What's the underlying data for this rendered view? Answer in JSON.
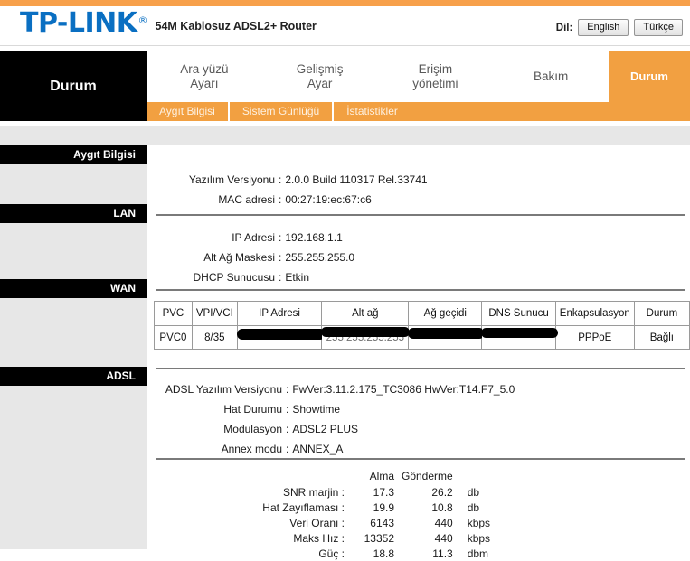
{
  "header": {
    "brand": "TP-LINK",
    "registered_mark": "®",
    "model": "54M Kablosuz ADSL2+ Router",
    "lang_label": "Dil:",
    "lang_buttons": [
      "English",
      "Türkçe"
    ]
  },
  "panel_title": "Durum",
  "nav": {
    "tabs": [
      {
        "label": "Ara yüzü\nAyarı",
        "active": false
      },
      {
        "label": "Gelişmiş\nAyar",
        "active": false
      },
      {
        "label": "Erişim\nyönetimi",
        "active": false
      },
      {
        "label": "Bakım",
        "active": false
      },
      {
        "label": "Durum",
        "active": true
      }
    ],
    "subnav": [
      {
        "label": "Aygıt Bilgisi",
        "active": true
      },
      {
        "label": "Sistem Günlüğü",
        "active": false
      },
      {
        "label": "İstatistikler",
        "active": false
      }
    ]
  },
  "sections": {
    "device_info": {
      "heading": "Aygıt Bilgisi",
      "rows": [
        {
          "key": "Yazılım Versiyonu",
          "value": "2.0.0 Build 110317 Rel.33741"
        },
        {
          "key": "MAC adresi",
          "value": "00:27:19:ec:67:c6"
        }
      ]
    },
    "lan": {
      "heading": "LAN",
      "rows": [
        {
          "key": "IP Adresi",
          "value": "192.168.1.1"
        },
        {
          "key": "Alt Ağ Maskesi",
          "value": "255.255.255.0"
        },
        {
          "key": "DHCP Sunucusu",
          "value": "Etkin"
        }
      ]
    },
    "wan": {
      "heading": "WAN",
      "columns": [
        "PVC",
        "VPI/VCI",
        "IP Adresi",
        "Alt ağ",
        "Ağ geçidi",
        "DNS Sunucu",
        "Enkapsulasyon",
        "Durum"
      ],
      "rows": [
        {
          "pvc": "PVC0",
          "vpi_vci": "8/35",
          "ip_adresi": "",
          "alt_ag": "255.255.255.255",
          "ag_gecidi": "",
          "dns_sunucu": "",
          "enkapsulasyon": "PPPoE",
          "durum": "Bağlı"
        }
      ]
    },
    "adsl": {
      "heading": "ADSL",
      "rows": [
        {
          "key": "ADSL Yazılım Versiyonu",
          "value": "FwVer:3.11.2.175_TC3086 HwVer:T14.F7_5.0"
        },
        {
          "key": "Hat Durumu",
          "value": "Showtime"
        },
        {
          "key": "Modulasyon",
          "value": "ADSL2 PLUS"
        },
        {
          "key": "Annex modu",
          "value": "ANNEX_A"
        }
      ],
      "stats": {
        "col_headers": [
          "Alma",
          "Gönderme"
        ],
        "rows": [
          {
            "label": "SNR marjin :",
            "alma": "17.3",
            "gonderme": "26.2",
            "unit": "db"
          },
          {
            "label": "Hat Zayıflaması :",
            "alma": "19.9",
            "gonderme": "10.8",
            "unit": "db"
          },
          {
            "label": "Veri Oranı :",
            "alma": "6143",
            "gonderme": "440",
            "unit": "kbps"
          },
          {
            "label": "Maks Hız :",
            "alma": "13352",
            "gonderme": "440",
            "unit": "kbps"
          },
          {
            "label": "Güç :",
            "alma": "18.8",
            "gonderme": "11.3",
            "unit": "dbm"
          }
        ]
      }
    }
  },
  "colors": {
    "accent_orange": "#f2a041",
    "top_strip": "#f7a04b",
    "brand_blue": "#0a6fc2",
    "sidebar_gray": "#e7e7e7",
    "section_black": "#000000"
  }
}
